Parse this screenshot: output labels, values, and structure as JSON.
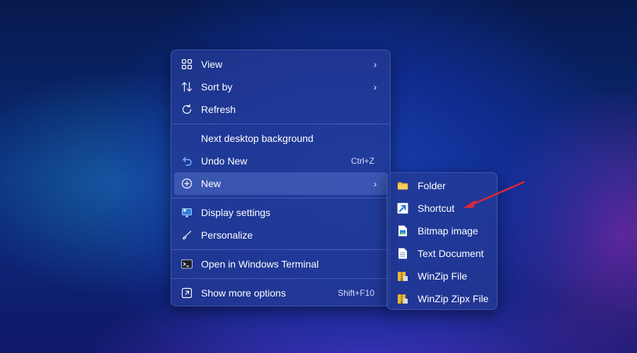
{
  "context_menu": {
    "items": [
      {
        "label": "View",
        "icon": "grid-icon"
      },
      {
        "label": "Sort by",
        "icon": "sort-icon"
      },
      {
        "label": "Refresh",
        "icon": "refresh-icon"
      },
      {
        "label": "Next desktop background"
      },
      {
        "label": "Undo New",
        "icon": "undo-icon",
        "shortcut": "Ctrl+Z"
      },
      {
        "label": "New",
        "icon": "add-circle-icon"
      },
      {
        "label": "Display settings",
        "icon": "display-icon"
      },
      {
        "label": "Personalize",
        "icon": "brush-icon"
      },
      {
        "label": "Open in Windows Terminal",
        "icon": "terminal-icon"
      },
      {
        "label": "Show more options",
        "icon": "expand-icon",
        "shortcut": "Shift+F10"
      }
    ],
    "highlighted": "New"
  },
  "new_submenu": {
    "items": [
      {
        "label": "Folder",
        "icon": "folder-icon"
      },
      {
        "label": "Shortcut",
        "icon": "shortcut-icon"
      },
      {
        "label": "Bitmap image",
        "icon": "bitmap-icon"
      },
      {
        "label": "Text Document",
        "icon": "text-document-icon"
      },
      {
        "label": "WinZip File",
        "icon": "winzip-icon"
      },
      {
        "label": "WinZip Zipx File",
        "icon": "winzip-zipx-icon"
      }
    ]
  },
  "colors": {
    "menu_background": "#263c96",
    "highlight": "#7896e6",
    "annotation_arrow": "#e0253a",
    "folder": "#f2c447"
  }
}
